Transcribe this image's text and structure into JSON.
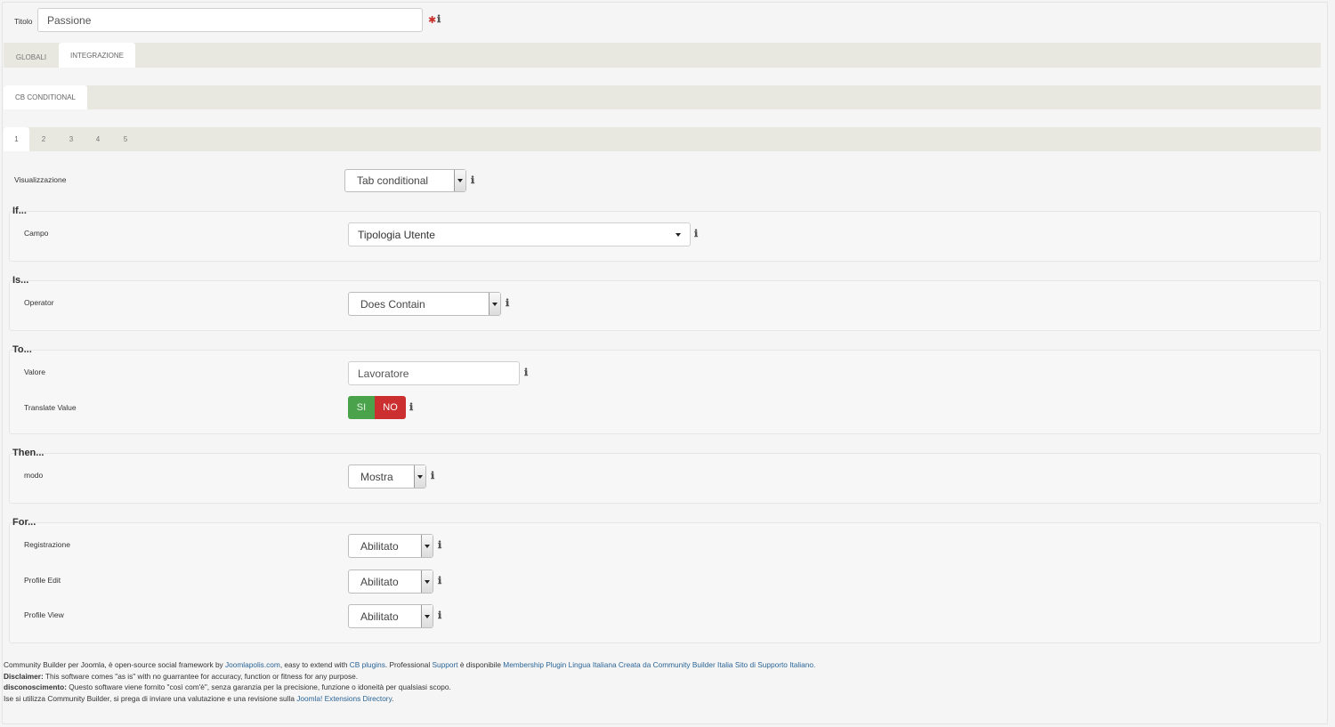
{
  "titolo": {
    "label": "Titolo",
    "value": "Passione",
    "required": "✱"
  },
  "main_tabs": [
    {
      "label": "GLOBALI",
      "active": false
    },
    {
      "label": "INTEGRAZIONE",
      "active": true
    }
  ],
  "sub_tabs": [
    {
      "label": "CB CONDITIONAL",
      "active": true
    }
  ],
  "num_tabs": [
    "1",
    "2",
    "3",
    "4",
    "5"
  ],
  "visualizzazione": {
    "label": "Visualizzazione",
    "value": "Tab conditional"
  },
  "if_section": {
    "legend": "If...",
    "campo_label": "Campo",
    "campo_value": "Tipologia Utente"
  },
  "is_section": {
    "legend": "Is...",
    "operator_label": "Operator",
    "operator_value": "Does Contain"
  },
  "to_section": {
    "legend": "To...",
    "valore_label": "Valore",
    "valore_value": "Lavoratore",
    "translate_label": "Translate Value",
    "toggle_yes": "SI",
    "toggle_no": "NO",
    "toggle_selected": "NO"
  },
  "then_section": {
    "legend": "Then...",
    "modo_label": "modo",
    "modo_value": "Mostra"
  },
  "for_section": {
    "legend": "For...",
    "registrazione_label": "Registrazione",
    "registrazione_value": "Abilitato",
    "profile_edit_label": "Profile Edit",
    "profile_edit_value": "Abilitato",
    "profile_view_label": "Profile View",
    "profile_view_value": "Abilitato"
  },
  "footer": {
    "line1_a": "Community Builder per Joomla, è open-source social framework by ",
    "link_joomlapolis": "Joomlapolis.com",
    "line1_b": ", easy to extend with ",
    "link_cb_plugins": "CB plugins",
    "line1_c": ". Professional ",
    "link_support": "Support",
    "line1_d": " è disponibile ",
    "link_membership": "Membership Plugin Lingua Italiana Creata da Community Builder Italia Sito di Supporto Italiano.",
    "disclaimer_label": "Disclaimer:",
    "disclaimer_text": " This software comes \"as is\" with no guarrantee for accuracy, function or fitness for any purpose.",
    "disconosc_label": "disconoscimento:",
    "disconosc_text": " Questo software viene fornito \"così com'è\", senza garanzia per la precisione, funzione o idoneità per qualsiasi scopo.",
    "line4_a": "Ise si utilizza Community Builder, si prega di inviare una valutazione e una revisione sulla ",
    "link_jed": "Joomla! Extensions Directory",
    "line4_b": "."
  },
  "icons": {
    "info": "ℹ",
    "required": "asterisk-icon",
    "dropdown": "chevron-down-icon"
  },
  "colors": {
    "toggle_yes": "#4aa24a",
    "toggle_no": "#cc2f2f",
    "link": "#2a6496"
  }
}
